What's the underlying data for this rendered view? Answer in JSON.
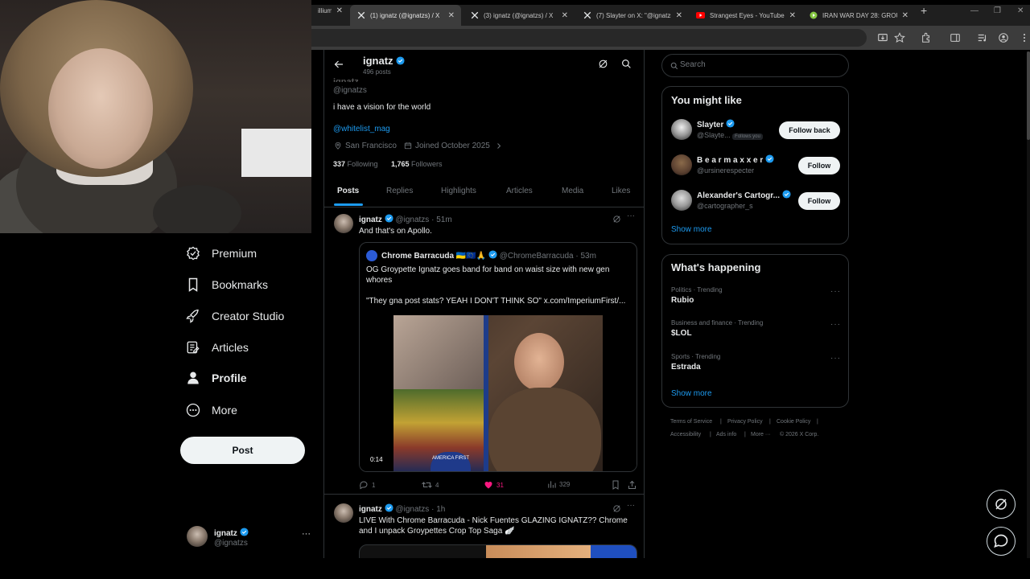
{
  "browser": {
    "tabs": [
      {
        "title": "illium",
        "active": false
      },
      {
        "title": "(1) ignatz (@ignatzs) / X",
        "active": true
      },
      {
        "title": "(3) ignatz (@ignatzs) / X",
        "active": false
      },
      {
        "title": "(7) Slayter on X: \"@ignatzs",
        "active": false
      },
      {
        "title": "Strangest Eyes - YouTube",
        "active": false
      },
      {
        "title": "IRAN WAR DAY 28: GROUND",
        "active": false
      }
    ],
    "new_tab": "+"
  },
  "nav": {
    "items": [
      {
        "label": "Premium",
        "icon": "premium-check-icon"
      },
      {
        "label": "Bookmarks",
        "icon": "bookmark-icon"
      },
      {
        "label": "Creator Studio",
        "icon": "rocket-icon"
      },
      {
        "label": "Articles",
        "icon": "article-icon"
      },
      {
        "label": "Profile",
        "icon": "person-icon"
      },
      {
        "label": "More",
        "icon": "more-circle-icon"
      }
    ],
    "post_label": "Post",
    "account": {
      "name": "ignatz",
      "handle": "@ignatzs",
      "more": "···"
    }
  },
  "profile": {
    "header_name": "ignatz",
    "header_posts": "496 posts",
    "name_partial": "ignatz",
    "handle": "@ignatzs",
    "bio": "i have a vision for the world",
    "link": "@whitelist_mag",
    "location": "San Francisco",
    "joined": "Joined October 2025",
    "following_count": "337",
    "following_label": "Following",
    "followers_count": "1,765",
    "followers_label": "Followers",
    "tabs": [
      "Posts",
      "Replies",
      "Highlights",
      "Articles",
      "Media",
      "Likes"
    ]
  },
  "tweets": [
    {
      "name": "ignatz",
      "handle": "@ignatzs",
      "time": "51m",
      "text": "And that's on Apollo.",
      "quote": {
        "name": "Chrome Barracuda",
        "emoji": "🇺🇦🇪🇺🙏",
        "handle": "@ChromeBarracuda",
        "time": "53m",
        "text1": "OG Groypette Ignatz goes band for band on waist size with new gen whores",
        "text2": "\"They gna post stats? YEAH I DON'T THINK SO\"",
        "link": "x.com/ImperiumFirst/...",
        "video_time": "0:14",
        "hat_text": "AMERICA FIRST"
      },
      "replies": "1",
      "reposts": "4",
      "likes": "31",
      "views": "329"
    },
    {
      "name": "ignatz",
      "handle": "@ignatzs",
      "time": "1h",
      "text": "LIVE With Chrome Barracuda - Nick Fuentes GLAZING IGNATZ?? Chrome and I unpack Groypettes Crop Top Saga 🪽"
    }
  ],
  "sidebar": {
    "search_placeholder": "Search",
    "might_like_title": "You might like",
    "suggestions": [
      {
        "name": "Slayter",
        "handle": "@Slayte...",
        "follows_you": "Follows you",
        "button": "Follow back"
      },
      {
        "name": "B e a r m a x x e r",
        "handle": "@ursinerespecter",
        "button": "Follow"
      },
      {
        "name": "Alexander's Cartogr...",
        "handle": "@cartographer_s",
        "button": "Follow"
      }
    ],
    "show_more": "Show more",
    "happening_title": "What's happening",
    "trends": [
      {
        "category": "Politics · Trending",
        "name": "Rubio"
      },
      {
        "category": "Business and finance · Trending",
        "name": "$LOL"
      },
      {
        "category": "Sports · Trending",
        "name": "Estrada"
      }
    ],
    "footer": [
      "Terms of Service",
      "|",
      "Privacy Policy",
      "|",
      "Cookie Policy",
      "|",
      "Accessibility",
      "|",
      "Ads info",
      "|",
      "More ···",
      "© 2026 X Corp."
    ]
  },
  "colors": {
    "accent": "#1d9bf0",
    "like": "#f91880",
    "border": "#2f3336"
  }
}
